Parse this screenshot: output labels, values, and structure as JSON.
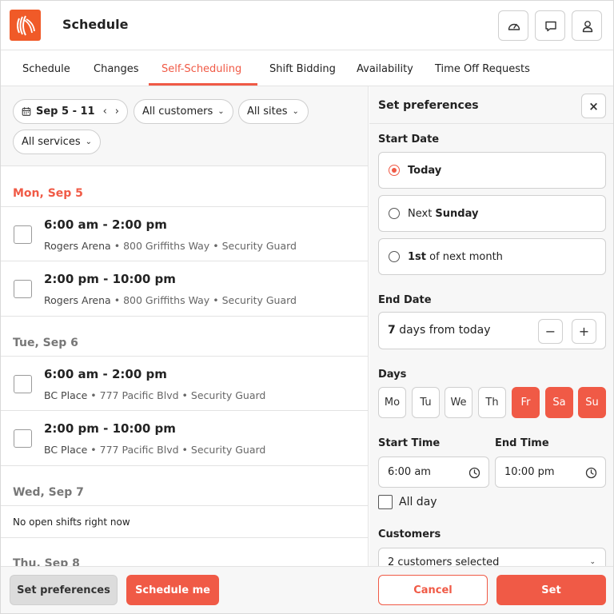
{
  "header": {
    "title": "Schedule",
    "icons": [
      "dashboard-icon",
      "chat-icon",
      "user-icon"
    ]
  },
  "tabs": [
    {
      "label": "Schedule"
    },
    {
      "label": "Changes"
    },
    {
      "label": "Self-Scheduling",
      "active": true
    },
    {
      "label": "Shift Bidding"
    },
    {
      "label": "Availability"
    },
    {
      "label": "Time Off Requests"
    }
  ],
  "filters": {
    "date_range": "Sep 5 - 11",
    "customers": "All customers",
    "sites": "All sites",
    "services": "All services"
  },
  "days": [
    {
      "heading": "Mon, Sep 5",
      "shifts": [
        {
          "time": "6:00 am - 2:00 pm",
          "site": "Rogers Arena",
          "address": "800 Griffiths Way",
          "role": "Security Guard"
        },
        {
          "time": "2:00 pm - 10:00 pm",
          "site": "Rogers Arena",
          "address": "800 Griffiths Way",
          "role": "Security Guard"
        }
      ]
    },
    {
      "heading": "Tue, Sep 6",
      "shifts": [
        {
          "time": "6:00 am - 2:00 pm",
          "site": "BC Place",
          "address": "777 Pacific Blvd",
          "role": "Security Guard"
        },
        {
          "time": "2:00 pm - 10:00 pm",
          "site": "BC Place",
          "address": "777 Pacific Blvd",
          "role": "Security Guard"
        }
      ]
    },
    {
      "heading": "Wed, Sep 7",
      "empty_text": "No open shifts right now"
    },
    {
      "heading": "Thu, Sep 8"
    }
  ],
  "separator": "•",
  "bottom_left": {
    "set_preferences": "Set preferences",
    "schedule_me": "Schedule me"
  },
  "preferences": {
    "title": "Set preferences",
    "close": "×",
    "start_date": {
      "label": "Start Date",
      "options": [
        {
          "prefix": "",
          "bold": "Today",
          "suffix": "",
          "selected": true
        },
        {
          "prefix": "Next ",
          "bold": "Sunday",
          "suffix": "",
          "selected": false
        },
        {
          "prefix": "",
          "bold": "1st",
          "suffix": " of next month",
          "selected": false
        }
      ]
    },
    "end_date": {
      "label": "End Date",
      "value": "7",
      "suffix": " days from today",
      "minus": "−",
      "plus": "+"
    },
    "days": {
      "label": "Days",
      "items": [
        {
          "label": "Mo",
          "on": false
        },
        {
          "label": "Tu",
          "on": false
        },
        {
          "label": "We",
          "on": false
        },
        {
          "label": "Th",
          "on": false
        },
        {
          "label": "Fr",
          "on": true
        },
        {
          "label": "Sa",
          "on": true
        },
        {
          "label": "Su",
          "on": true
        }
      ]
    },
    "start_time": {
      "label": "Start Time",
      "value": "6:00 am"
    },
    "end_time": {
      "label": "End Time",
      "value": "10:00 pm"
    },
    "all_day": {
      "label": "All day",
      "checked": false
    },
    "customers": {
      "label": "Customers",
      "value": "2 customers selected"
    },
    "cancel": "Cancel",
    "set": "Set"
  },
  "colors": {
    "accent": "#f05a46",
    "logo": "#f05a28"
  }
}
